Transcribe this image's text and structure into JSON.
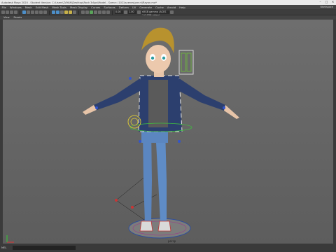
{
  "window": {
    "title": "Autodesk Maya 2020 - Student Version: C:\\Users\\ZAYAN\\Desktop\\Rock 3d\\ps\\Model - Scene: (102)\\scenes\\pre.ni\\Rayan.ma*",
    "workspace_label": "Workspace"
  },
  "menubar": [
    "File",
    "Windows",
    "Mesh",
    "Edit Mesh",
    "Mesh Tools",
    "Mesh Display",
    "Curves",
    "Surfaces",
    "Deform",
    "UV",
    "Generate",
    "Cache",
    "Arnold",
    "Help"
  ],
  "shelf": {
    "field_a": "0.00",
    "field_b": "1.00",
    "camera_label": "sRGB gamma (ACES 1.0 SDR-video)"
  },
  "panel_menu": {
    "items": [
      "View",
      "Panels"
    ],
    "persp": "persp"
  },
  "statusbar": {
    "mel": "MEL"
  }
}
